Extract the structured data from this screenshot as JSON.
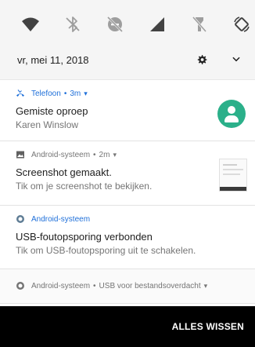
{
  "quick_settings": {
    "tiles": [
      {
        "icon": "wifi-icon"
      },
      {
        "icon": "bluetooth-off-icon"
      },
      {
        "icon": "do-not-disturb-off-icon"
      },
      {
        "icon": "cellular-signal-icon"
      },
      {
        "icon": "flashlight-off-icon"
      },
      {
        "icon": "auto-rotate-icon"
      }
    ],
    "date": "vr, mei 11, 2018",
    "settings_icon": "gear-icon",
    "expand_icon": "chevron-down-icon"
  },
  "notifications": [
    {
      "app": "Telefoon",
      "time": "3m",
      "title": "Gemiste oproep",
      "text": "Karen Winslow",
      "icon": "missed-call-icon",
      "accent": "#1e6fd9",
      "avatar_color": "#2bb08a"
    },
    {
      "app": "Android-systeem",
      "time": "2m",
      "title": "Screenshot gemaakt.",
      "text": "Tik om je screenshot te bekijken.",
      "icon": "image-icon"
    },
    {
      "app": "Android-systeem",
      "title": "USB-foutopsporing verbonden",
      "text": "Tik om USB-foutopsporing uit te schakelen.",
      "icon": "android-system-icon"
    }
  ],
  "summary": {
    "app": "Android-systeem",
    "text": "USB voor bestandsoverdacht",
    "separator": "•"
  },
  "actions": {
    "clear_all": "ALLES WISSEN"
  },
  "colors": {
    "accent_blue": "#1e6fd9",
    "avatar_green": "#2bb08a",
    "bar_black": "#000000"
  }
}
